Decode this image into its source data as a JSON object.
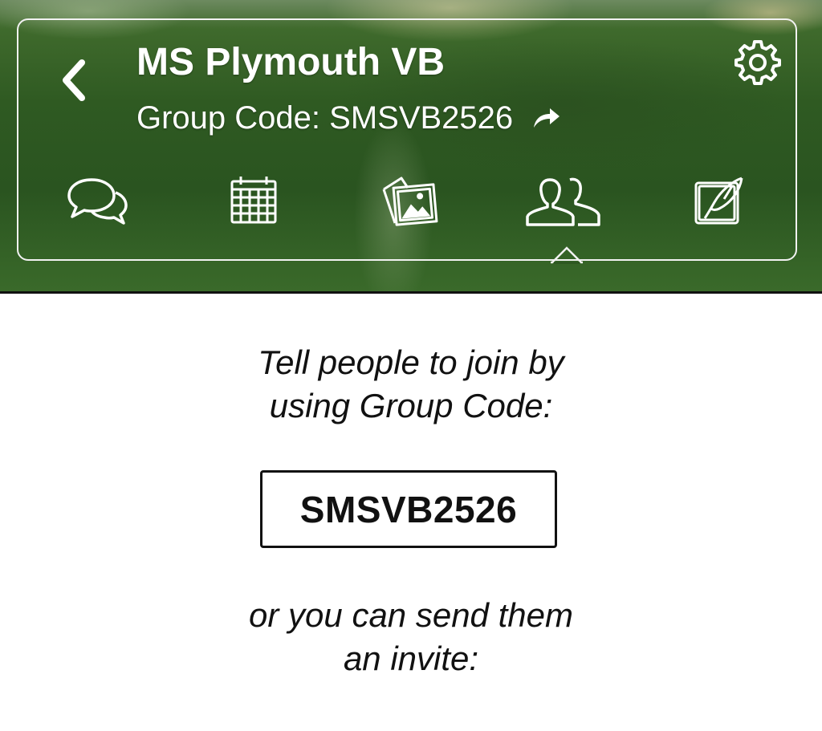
{
  "header": {
    "title": "MS Plymouth VB",
    "group_code_line": "Group Code: SMSVB2526",
    "back_icon": "chevron-left-icon",
    "share_icon": "share-arrow-icon",
    "settings_icon": "gear-icon"
  },
  "nav": {
    "active_tab": "members",
    "tabs": [
      {
        "id": "chat",
        "icon": "chat-bubbles-icon"
      },
      {
        "id": "calendar",
        "icon": "calendar-icon"
      },
      {
        "id": "photos",
        "icon": "photos-icon"
      },
      {
        "id": "members",
        "icon": "people-icon"
      },
      {
        "id": "notes",
        "icon": "quill-note-icon"
      }
    ]
  },
  "content": {
    "instruction_line1": "Tell people to join by",
    "instruction_line2": "using Group Code:",
    "group_code": "SMSVB2526",
    "invite_line1": "or you can send them",
    "invite_line2": "an invite:"
  },
  "colors": {
    "header_green": "#2f5a22",
    "text_dark": "#111111",
    "header_text": "#ffffff"
  }
}
